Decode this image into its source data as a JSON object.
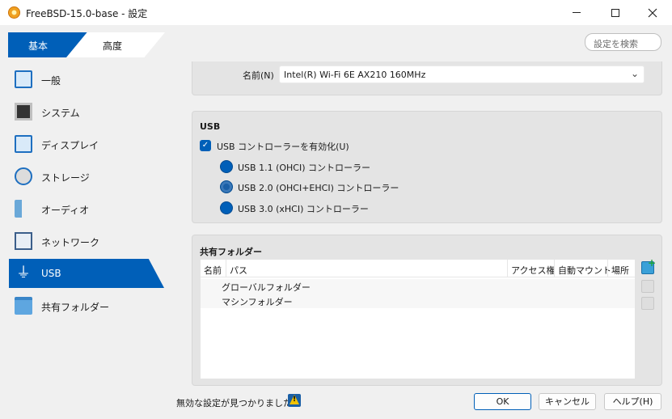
{
  "window": {
    "title": "FreeBSD-15.0-base - 設定"
  },
  "tabs": {
    "basic": "基本",
    "advanced": "高度"
  },
  "search": {
    "placeholder": "設定を検索"
  },
  "sidebar": {
    "items": [
      {
        "label": "一般",
        "icon": "monitor-icon"
      },
      {
        "label": "システム",
        "icon": "chip-icon"
      },
      {
        "label": "ディスプレイ",
        "icon": "display-icon"
      },
      {
        "label": "ストレージ",
        "icon": "disk-icon"
      },
      {
        "label": "オーディオ",
        "icon": "speaker-icon"
      },
      {
        "label": "ネットワーク",
        "icon": "network-icon"
      },
      {
        "label": "USB",
        "icon": "usb-icon",
        "active": true
      },
      {
        "label": "共有フォルダー",
        "icon": "folder-icon"
      }
    ]
  },
  "network": {
    "name_label": "名前(N)",
    "name_value": "Intel(R) Wi-Fi 6E AX210 160MHz"
  },
  "usb": {
    "title": "USB",
    "enable_label": "USB コントローラーを有効化(U)",
    "enabled": true,
    "options": [
      {
        "label": "USB 1.1 (OHCI) コントローラー",
        "selected": false
      },
      {
        "label": "USB 2.0 (OHCI+EHCI) コントローラー",
        "selected": true
      },
      {
        "label": "USB 3.0 (xHCI) コントローラー",
        "selected": false
      }
    ]
  },
  "shared": {
    "title": "共有フォルダー",
    "columns": [
      "名前",
      "パス",
      "アクセス権",
      "自動マウント",
      "場所"
    ],
    "rows": [
      "グローバルフォルダー",
      "マシンフォルダー"
    ]
  },
  "footer": {
    "warning": "無効な設定が見つかりました",
    "ok": "OK",
    "cancel": "キャンセル",
    "help": "ヘルプ(H)"
  },
  "colors": {
    "accent": "#005fb8",
    "panel": "#e4e4e4"
  }
}
